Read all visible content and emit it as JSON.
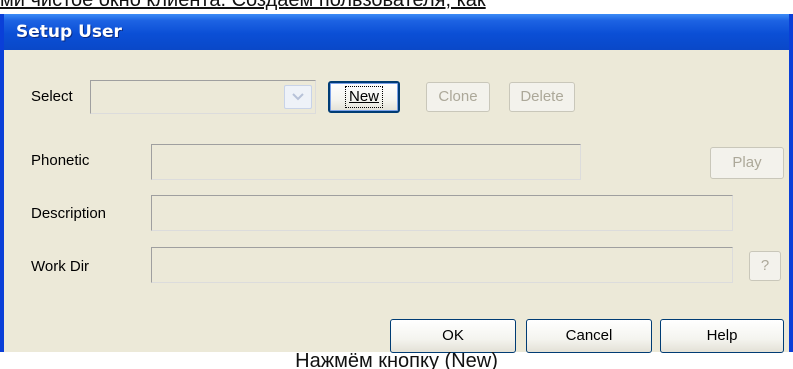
{
  "caption_top": "ми чистое окно клиента. Создаем пользователя, как",
  "caption_bottom": "Нажмём кнопку (New)",
  "dialog": {
    "title": "Setup User",
    "select_label": "Select",
    "select_value": "",
    "new_label": "New",
    "clone_label": "Clone",
    "delete_label": "Delete",
    "phonetic_label": "Phonetic",
    "phonetic_value": "",
    "play_label": "Play",
    "description_label": "Description",
    "description_value": "",
    "workdir_label": "Work Dir",
    "workdir_value": "",
    "browse_label": "?",
    "ok_label": "OK",
    "cancel_label": "Cancel",
    "help_label": "Help"
  },
  "colors": {
    "title_bar": "#0a48c8",
    "dialog_bg": "#ece9d8",
    "disabled_text": "#aca899"
  }
}
